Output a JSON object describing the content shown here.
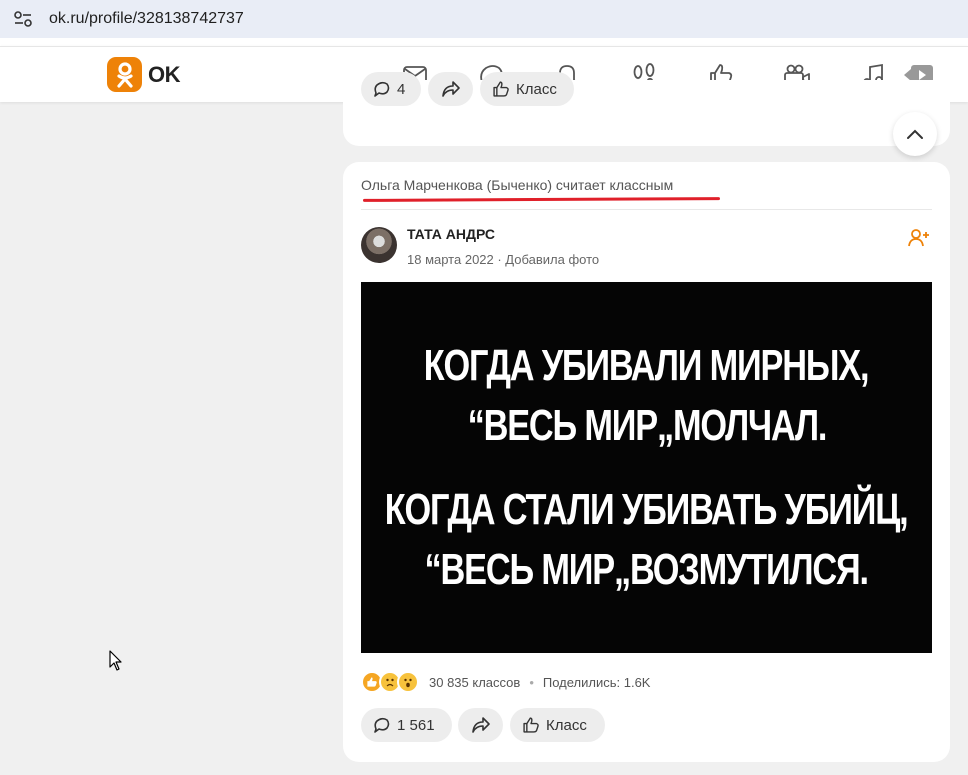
{
  "browser": {
    "url": "ok.ru/profile/328138742737"
  },
  "brand": {
    "name": "OK",
    "accent": "#ee8208"
  },
  "nav": {
    "icons": [
      "mail-icon",
      "discussions-icon",
      "notifications-icon",
      "guests-icon",
      "likes-icon",
      "video-icon",
      "music-icon",
      "video-play-icon"
    ]
  },
  "prev_post": {
    "comments": "4",
    "like_label": "Класс"
  },
  "post": {
    "liked_by": "Ольга Марченкова (Быченко) считает классным",
    "author": "ТАТА АНДРС",
    "meta": "18 марта 2022 · Добавила фото",
    "image_text": [
      "КОГДА УБИВАЛИ МИРНЫХ,",
      "“ВЕСЬ МИР„МОЛЧАЛ.",
      "КОГДА СТАЛИ УБИВАТЬ УБИЙЦ,",
      "“ВЕСЬ МИР„ВОЗМУТИЛСЯ."
    ],
    "reactions": [
      "like-reaction-icon",
      "sad-reaction-icon",
      "wow-reaction-icon"
    ],
    "likes_count": "30 835 классов",
    "shares": "Поделились: 1.6K",
    "comments": "1 561",
    "like_label": "Класс"
  },
  "colors": {
    "highlight_underline": "#e0202a"
  }
}
